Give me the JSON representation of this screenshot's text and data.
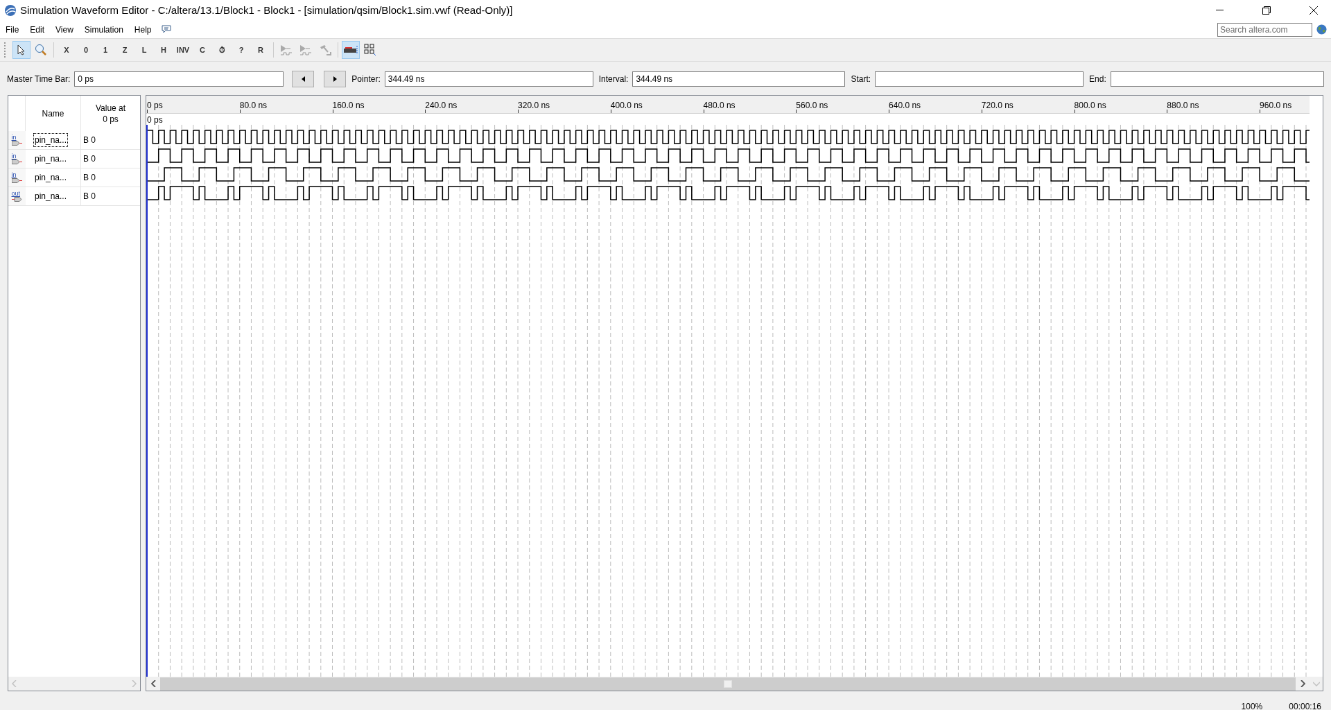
{
  "window": {
    "title": "Simulation Waveform Editor - C:/altera/13.1/Block1 - Block1 - [simulation/qsim/Block1.sim.vwf (Read-Only)]"
  },
  "menu": [
    "File",
    "Edit",
    "View",
    "Simulation",
    "Help"
  ],
  "search": {
    "placeholder": "Search altera.com"
  },
  "toolbar": [
    {
      "kind": "pointer",
      "selected": true
    },
    {
      "kind": "zoom",
      "selected": false
    },
    {
      "kind": "sep"
    },
    {
      "kind": "glyph",
      "label": "X",
      "selected": false
    },
    {
      "kind": "glyph",
      "label": "0",
      "selected": false
    },
    {
      "kind": "glyph",
      "label": "1",
      "selected": false
    },
    {
      "kind": "glyph",
      "label": "Z",
      "selected": false
    },
    {
      "kind": "glyph",
      "label": "L",
      "selected": false
    },
    {
      "kind": "glyph",
      "label": "H",
      "selected": false
    },
    {
      "kind": "glyph",
      "label": "INV",
      "selected": false
    },
    {
      "kind": "glyph",
      "label": "C",
      "selected": false
    },
    {
      "kind": "glyph",
      "label": "⏱",
      "selected": false
    },
    {
      "kind": "glyph",
      "label": "?",
      "selected": false
    },
    {
      "kind": "glyph",
      "label": "R",
      "selected": false
    },
    {
      "kind": "sep"
    },
    {
      "kind": "run",
      "selected": false
    },
    {
      "kind": "run2",
      "selected": false
    },
    {
      "kind": "hammer",
      "selected": false
    },
    {
      "kind": "sep"
    },
    {
      "kind": "snap",
      "selected": true
    },
    {
      "kind": "grid",
      "selected": false
    }
  ],
  "time_bar": {
    "master_label": "Master Time Bar:",
    "master_value": "0 ps",
    "pointer_label": "Pointer:",
    "pointer_value": "344.49 ns",
    "interval_label": "Interval:",
    "interval_value": "344.49 ns",
    "start_label": "Start:",
    "end_label": "End:"
  },
  "signal_list": {
    "columns": [
      "Name",
      "Value at\n0 ps"
    ],
    "rows": [
      {
        "kind": "in",
        "direction": "in",
        "name": "pin_na...",
        "value": "B 0"
      },
      {
        "kind": "in",
        "direction": "in",
        "name": "pin_na...",
        "value": "B 0"
      },
      {
        "kind": "in",
        "direction": "in",
        "name": "pin_na...",
        "value": "B 0"
      },
      {
        "kind": "out",
        "direction": "out",
        "name": "pin_na...",
        "value": "B 0"
      }
    ]
  },
  "ruler": {
    "labels": [
      "0 ps",
      "80.0 ns",
      "160.0 ns",
      "240.0 ns",
      "320.0 ns",
      "400.0 ns",
      "480.0 ns",
      "560.0 ns",
      "640.0 ns",
      "720.0 ns",
      "800.0 ns",
      "880.0 ns",
      "960.0 ns"
    ],
    "marker": "0 ps"
  },
  "status_bar": {
    "zoom": "100%",
    "time": "00:00:16"
  }
}
